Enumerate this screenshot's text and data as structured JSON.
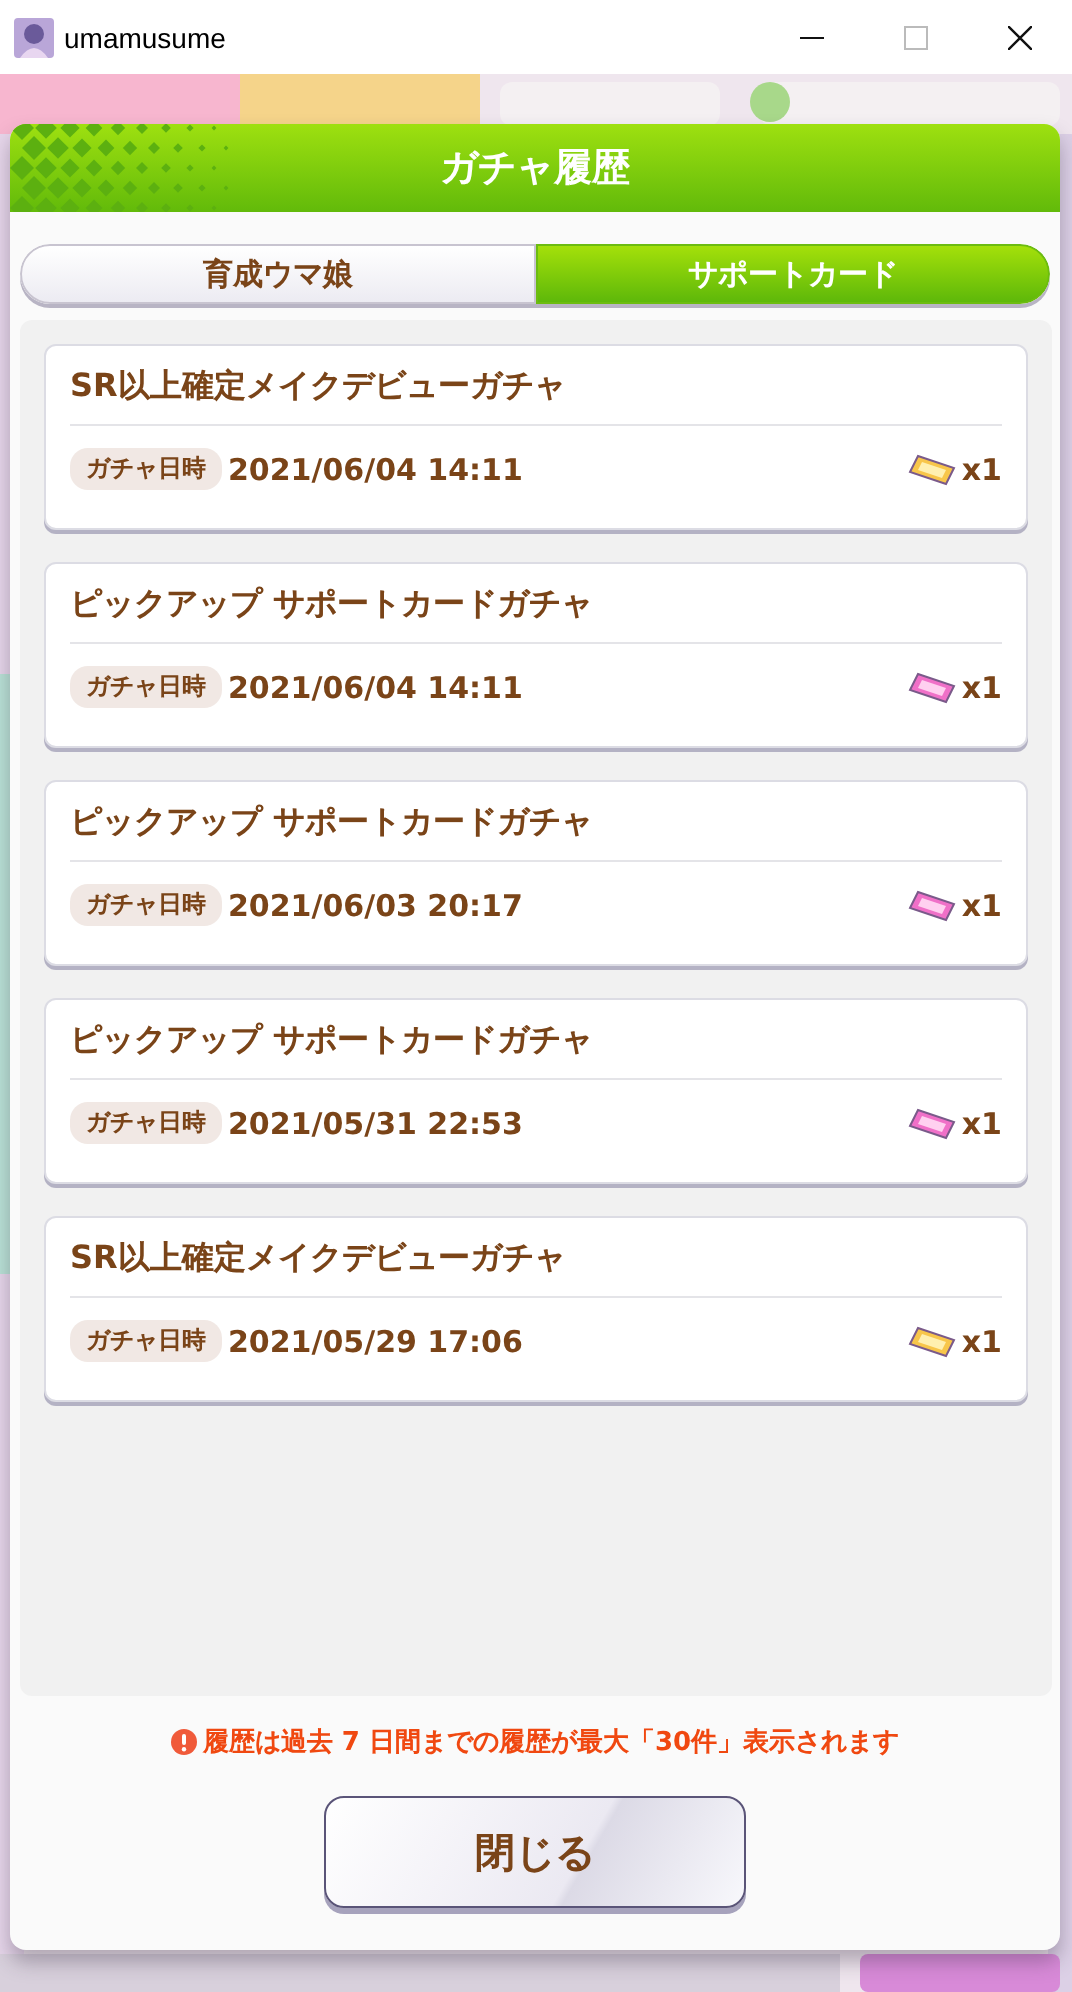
{
  "window": {
    "title": "umamusume"
  },
  "dialog": {
    "title": "ガチャ履歴",
    "tabs": [
      {
        "label": "育成ウマ娘",
        "selected": false
      },
      {
        "label": "サポートカード",
        "selected": true
      }
    ],
    "entries": [
      {
        "name": "SR以上確定メイクデビューガチャ",
        "date_label": "ガチャ日時",
        "date": "2021/06/04 14:11",
        "kind": "gold",
        "count": "x1"
      },
      {
        "name": "ピックアップ サポートカードガチャ",
        "date_label": "ガチャ日時",
        "date": "2021/06/04 14:11",
        "kind": "pink",
        "count": "x1"
      },
      {
        "name": "ピックアップ サポートカードガチャ",
        "date_label": "ガチャ日時",
        "date": "2021/06/03 20:17",
        "kind": "pink",
        "count": "x1"
      },
      {
        "name": "ピックアップ サポートカードガチャ",
        "date_label": "ガチャ日時",
        "date": "2021/05/31 22:53",
        "kind": "pink",
        "count": "x1"
      },
      {
        "name": "SR以上確定メイクデビューガチャ",
        "date_label": "ガチャ日時",
        "date": "2021/05/29 17:06",
        "kind": "gold",
        "count": "x1"
      }
    ],
    "note": "履歴は過去 7 日間までの履歴が最大「30件」表示されます",
    "close_button": "閉じる"
  }
}
